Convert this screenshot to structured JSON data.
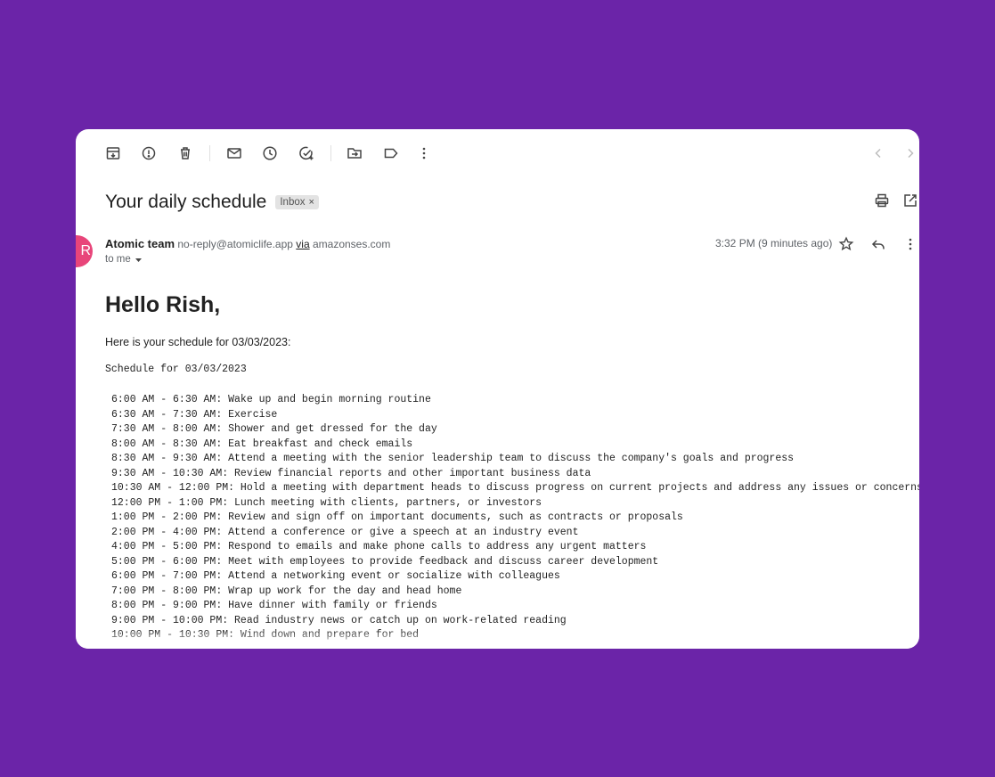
{
  "email": {
    "subject": "Your daily schedule",
    "label": "Inbox",
    "label_remove": "×",
    "avatar_letter": "R",
    "sender_name": "Atomic team",
    "sender_email": "no-reply@atomiclife.app",
    "via_label": "via",
    "via_domain": "amazonses.com",
    "recipient": "to me",
    "time": "3:32 PM (9 minutes ago)",
    "greeting": "Hello Rish,",
    "intro": "Here is your schedule for 03/03/2023:",
    "schedule_title": "Schedule for 03/03/2023",
    "schedule": [
      "6:00 AM - 6:30 AM: Wake up and begin morning routine",
      "6:30 AM - 7:30 AM: Exercise",
      "7:30 AM - 8:00 AM: Shower and get dressed for the day",
      "8:00 AM - 8:30 AM: Eat breakfast and check emails",
      "8:30 AM - 9:30 AM: Attend a meeting with the senior leadership team to discuss the company's goals and progress",
      "9:30 AM - 10:30 AM: Review financial reports and other important business data",
      "10:30 AM - 12:00 PM: Hold a meeting with department heads to discuss progress on current projects and address any issues or concerns",
      "12:00 PM - 1:00 PM: Lunch meeting with clients, partners, or investors",
      "1:00 PM - 2:00 PM: Review and sign off on important documents, such as contracts or proposals",
      "2:00 PM - 4:00 PM: Attend a conference or give a speech at an industry event",
      "4:00 PM - 5:00 PM: Respond to emails and make phone calls to address any urgent matters",
      "5:00 PM - 6:00 PM: Meet with employees to provide feedback and discuss career development",
      "6:00 PM - 7:00 PM: Attend a networking event or socialize with colleagues",
      "7:00 PM - 8:00 PM: Wrap up work for the day and head home",
      "8:00 PM - 9:00 PM: Have dinner with family or friends",
      "9:00 PM - 10:00 PM: Read industry news or catch up on work-related reading",
      "10:00 PM - 10:30 PM: Wind down and prepare for bed"
    ]
  },
  "toolbar_icons": [
    "archive-icon",
    "report-spam-icon",
    "delete-icon",
    "mark-unread-icon",
    "snooze-icon",
    "add-task-icon",
    "move-to-icon",
    "label-icon",
    "more-vertical-icon",
    "prev-icon",
    "next-icon"
  ],
  "colors": {
    "background": "#6b24a8",
    "avatar": "#e8457a",
    "card": "#ffffff"
  }
}
